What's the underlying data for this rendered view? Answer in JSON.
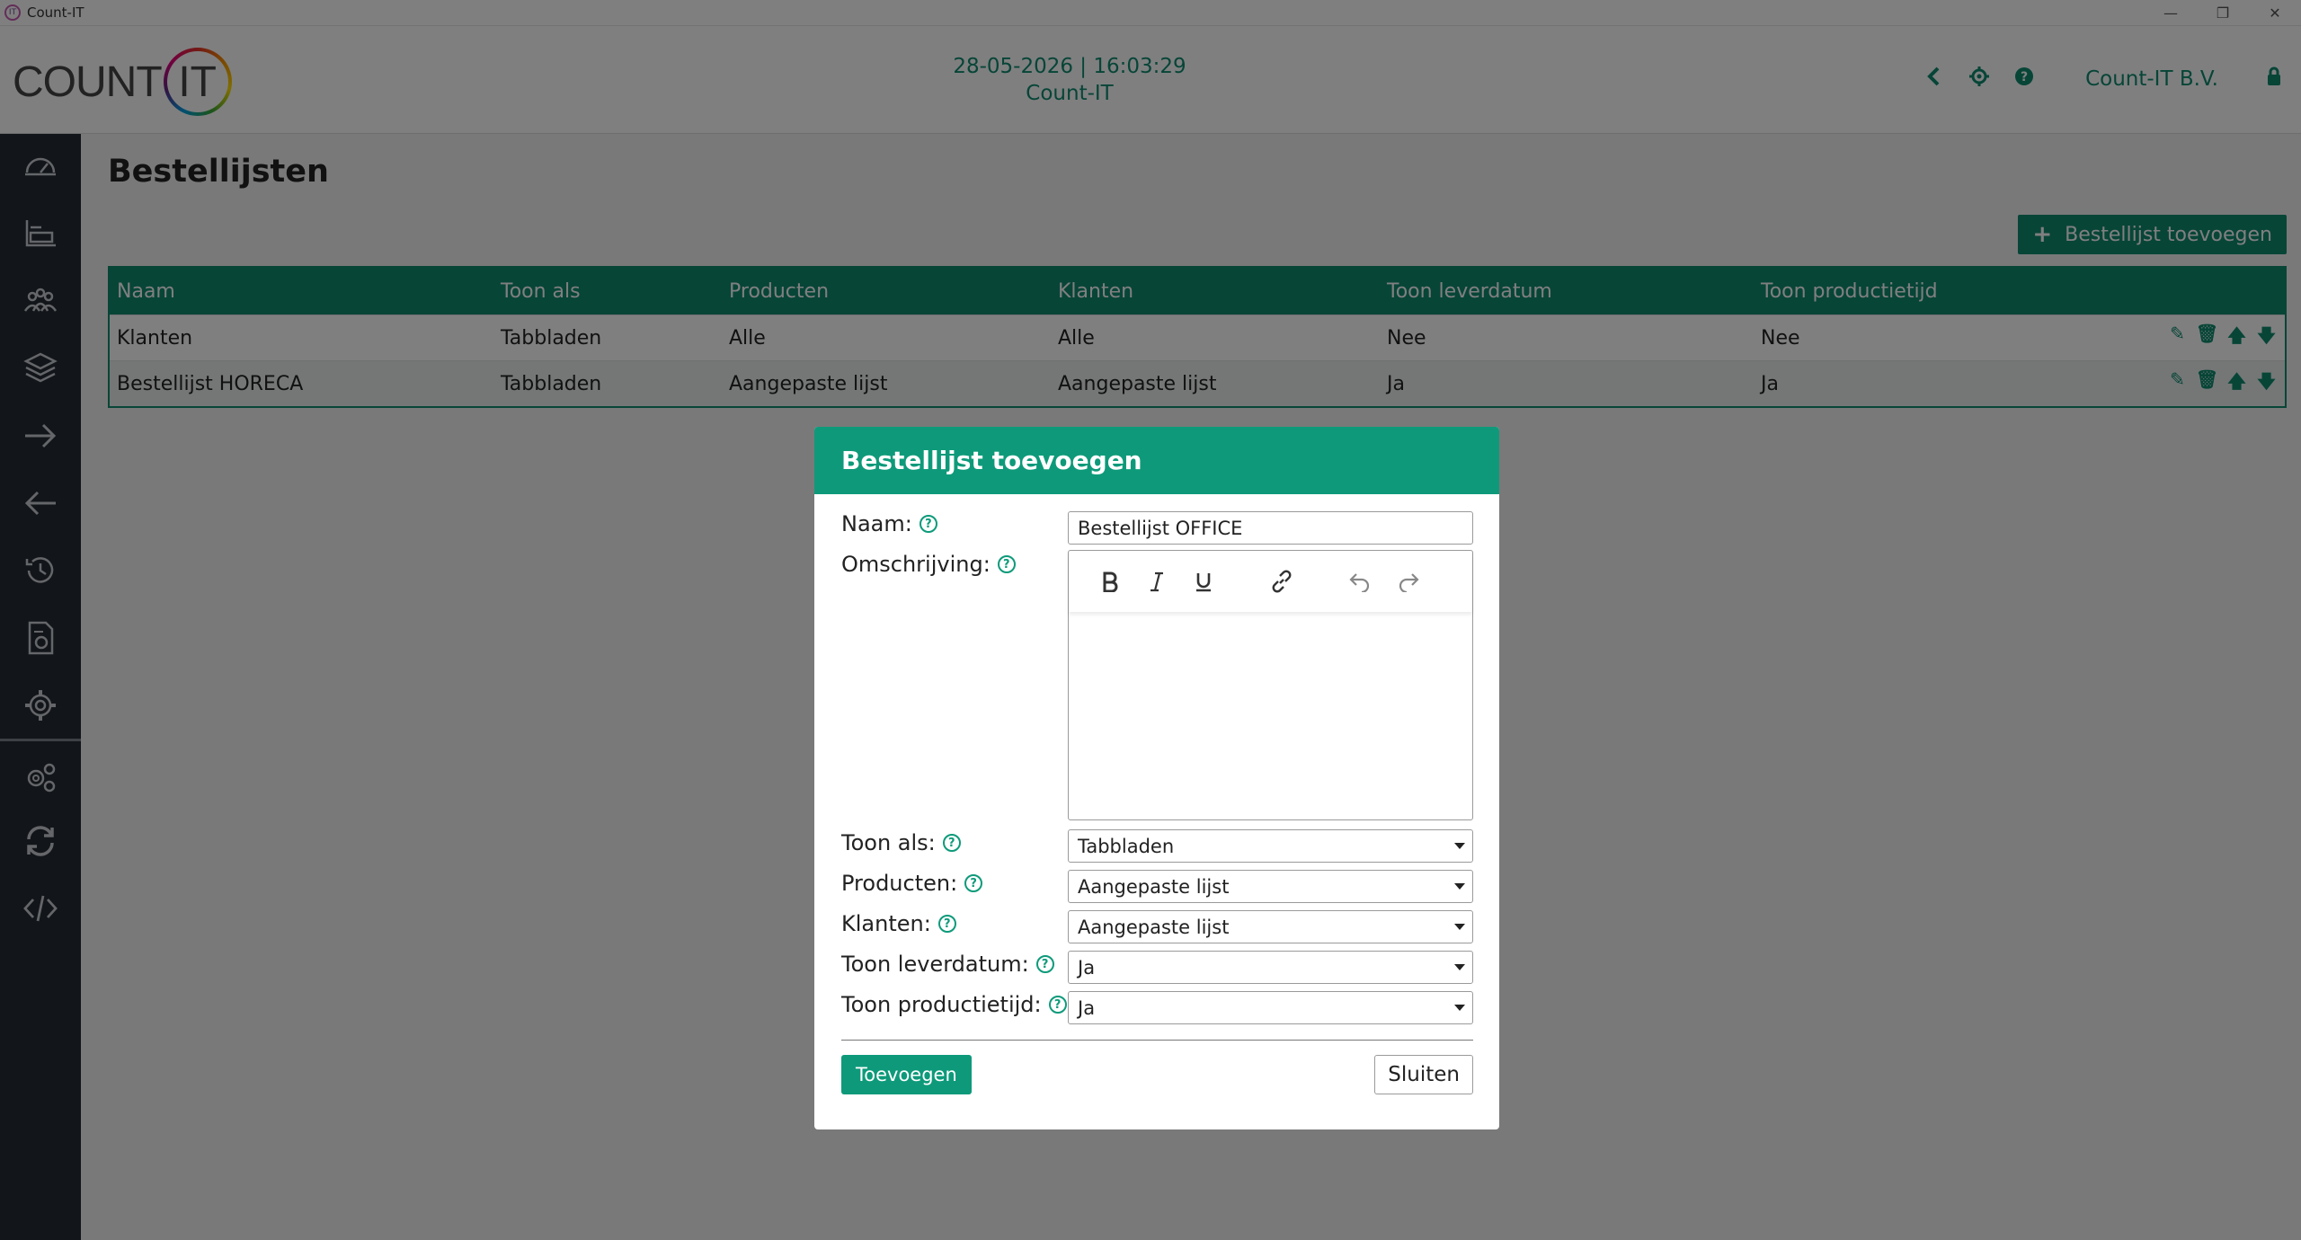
{
  "window": {
    "title": "Count-IT"
  },
  "header": {
    "logo_text": "COUNT",
    "logo_it": "IT",
    "datetime": "28-05-2026 | 16:03:29",
    "subtitle": "Count-IT",
    "company": "Count-IT B.V.",
    "icons": [
      "chevron-left-icon",
      "settings-icon",
      "help-icon",
      "lock-icon"
    ]
  },
  "sidebar": {
    "items": [
      "dashboard-icon",
      "stock-icon",
      "customers-icon",
      "products-icon",
      "arrow-right-icon",
      "arrow-left-icon",
      "history-icon",
      "report-icon",
      "settings-icon",
      "multi-settings-icon",
      "sync-icon",
      "code-icon"
    ]
  },
  "page": {
    "title": "Bestellijsten",
    "add_button": "Bestellijst toevoegen"
  },
  "table": {
    "headers": [
      "Naam",
      "Toon als",
      "Producten",
      "Klanten",
      "Toon leverdatum",
      "Toon productietijd"
    ],
    "rows": [
      [
        "Klanten",
        "Tabbladen",
        "Alle",
        "Alle",
        "Nee",
        "Nee"
      ],
      [
        "Bestellijst HORECA",
        "Tabbladen",
        "Aangepaste lijst",
        "Aangepaste lijst",
        "Ja",
        "Ja"
      ]
    ]
  },
  "modal": {
    "title": "Bestellijst toevoegen",
    "labels": {
      "naam": "Naam:",
      "omschrijving": "Omschrijving:",
      "toon_als": "Toon als:",
      "producten": "Producten:",
      "klanten": "Klanten:",
      "toon_leverdatum": "Toon leverdatum:",
      "toon_productietijd": "Toon productietijd:"
    },
    "values": {
      "naam": "Bestellijst OFFICE",
      "toon_als": "Tabbladen",
      "producten": "Aangepaste lijst",
      "klanten": "Aangepaste lijst",
      "toon_leverdatum": "Ja",
      "toon_productietijd": "Ja"
    },
    "submit": "Toevoegen",
    "close": "Sluiten",
    "help_glyph": "?"
  },
  "colors": {
    "accent": "#0e8a6f",
    "sidebar": "#252a33"
  }
}
